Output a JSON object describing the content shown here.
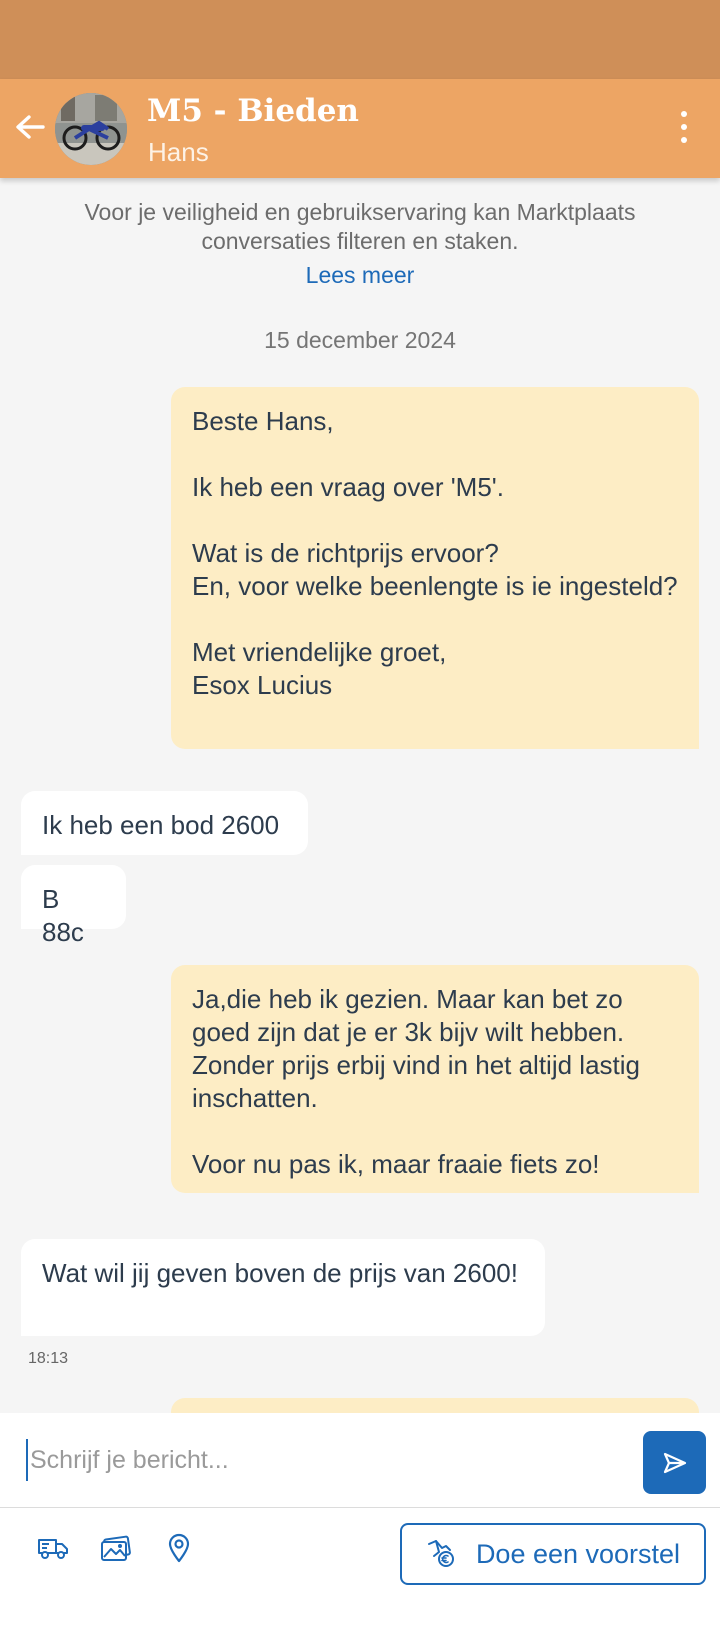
{
  "header": {
    "title": "M5 - Bieden",
    "subtitle": "Hans",
    "back_icon": "arrow-left-icon",
    "menu_icon": "more-vertical-icon"
  },
  "notice": {
    "text": "Voor je veiligheid en gebruikservaring kan Marktplaats conversaties filteren en staken.",
    "link": "Lees meer"
  },
  "date_separator": "15 december 2024",
  "messages": [
    {
      "direction": "sent",
      "text": "Beste Hans,\n\nIk heb een vraag over 'M5'.\n\nWat is de richtprijs ervoor?\nEn, voor welke beenlengte is ie ingesteld?\n\nMet vriendelijke groet,\nEsox Lucius"
    },
    {
      "direction": "received",
      "text": "Ik heb een bod 2600"
    },
    {
      "direction": "received",
      "text": "B 88c"
    },
    {
      "direction": "sent",
      "text": "Ja,die heb ik gezien. Maar kan bet zo goed zijn dat je er 3k bijv wilt hebben. Zonder prijs erbij vind in het altijd lastig inschatten.\n\nVoor nu pas ik, maar fraaie fiets zo!"
    },
    {
      "direction": "received",
      "text": "Wat wil jij geven boven de prijs van 2600!",
      "time": "18:13"
    }
  ],
  "composer": {
    "placeholder": "Schrijf je bericht...",
    "send_icon": "send-icon"
  },
  "toolbar": {
    "icons": [
      "delivery-truck-icon",
      "images-icon",
      "location-pin-icon"
    ],
    "offer_label": "Doe een voorstel",
    "offer_icon": "hand-coin-icon"
  },
  "colors": {
    "status_bar": "#cf8f58",
    "header": "#eda564",
    "sent_bubble": "#fdedc5",
    "received_bubble": "#ffffff",
    "accent": "#1d6ab8",
    "background": "#f5f5f5"
  }
}
